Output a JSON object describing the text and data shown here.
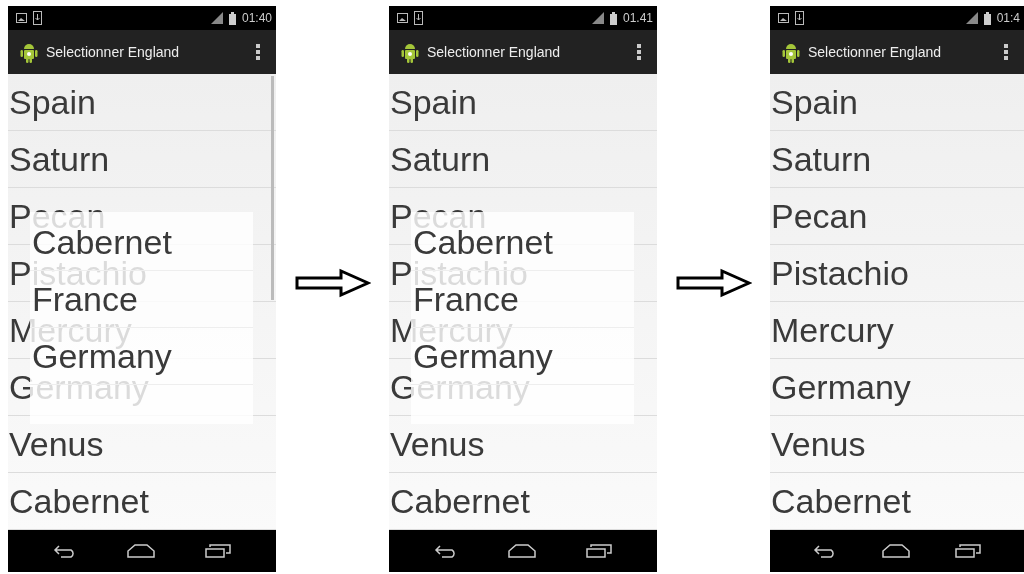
{
  "screens": [
    {
      "status_time": "01:40",
      "title": "Selectionner England",
      "scrollbar": true,
      "items": [
        "Spain",
        "Saturn",
        "Pecan",
        "Pistachio",
        "Mercury",
        "Germany",
        "Venus",
        "Cabernet"
      ],
      "popup": {
        "items": [
          "Cabernet",
          "France",
          "Germany"
        ]
      }
    },
    {
      "status_time": "01.41",
      "title": "Selectionner England",
      "items": [
        "Spain",
        "Saturn",
        "Pecan",
        "Pistachio",
        "Mercury",
        "Germany",
        "Venus",
        "Cabernet"
      ],
      "popup": {
        "items": [
          "Cabernet",
          "France",
          "Germany"
        ]
      }
    },
    {
      "status_time": "01:4",
      "title": "Selectionner England",
      "items": [
        "Spain",
        "Saturn",
        "Pecan",
        "Pistachio",
        "Mercury",
        "Germany",
        "Venus",
        "Cabernet"
      ]
    }
  ]
}
